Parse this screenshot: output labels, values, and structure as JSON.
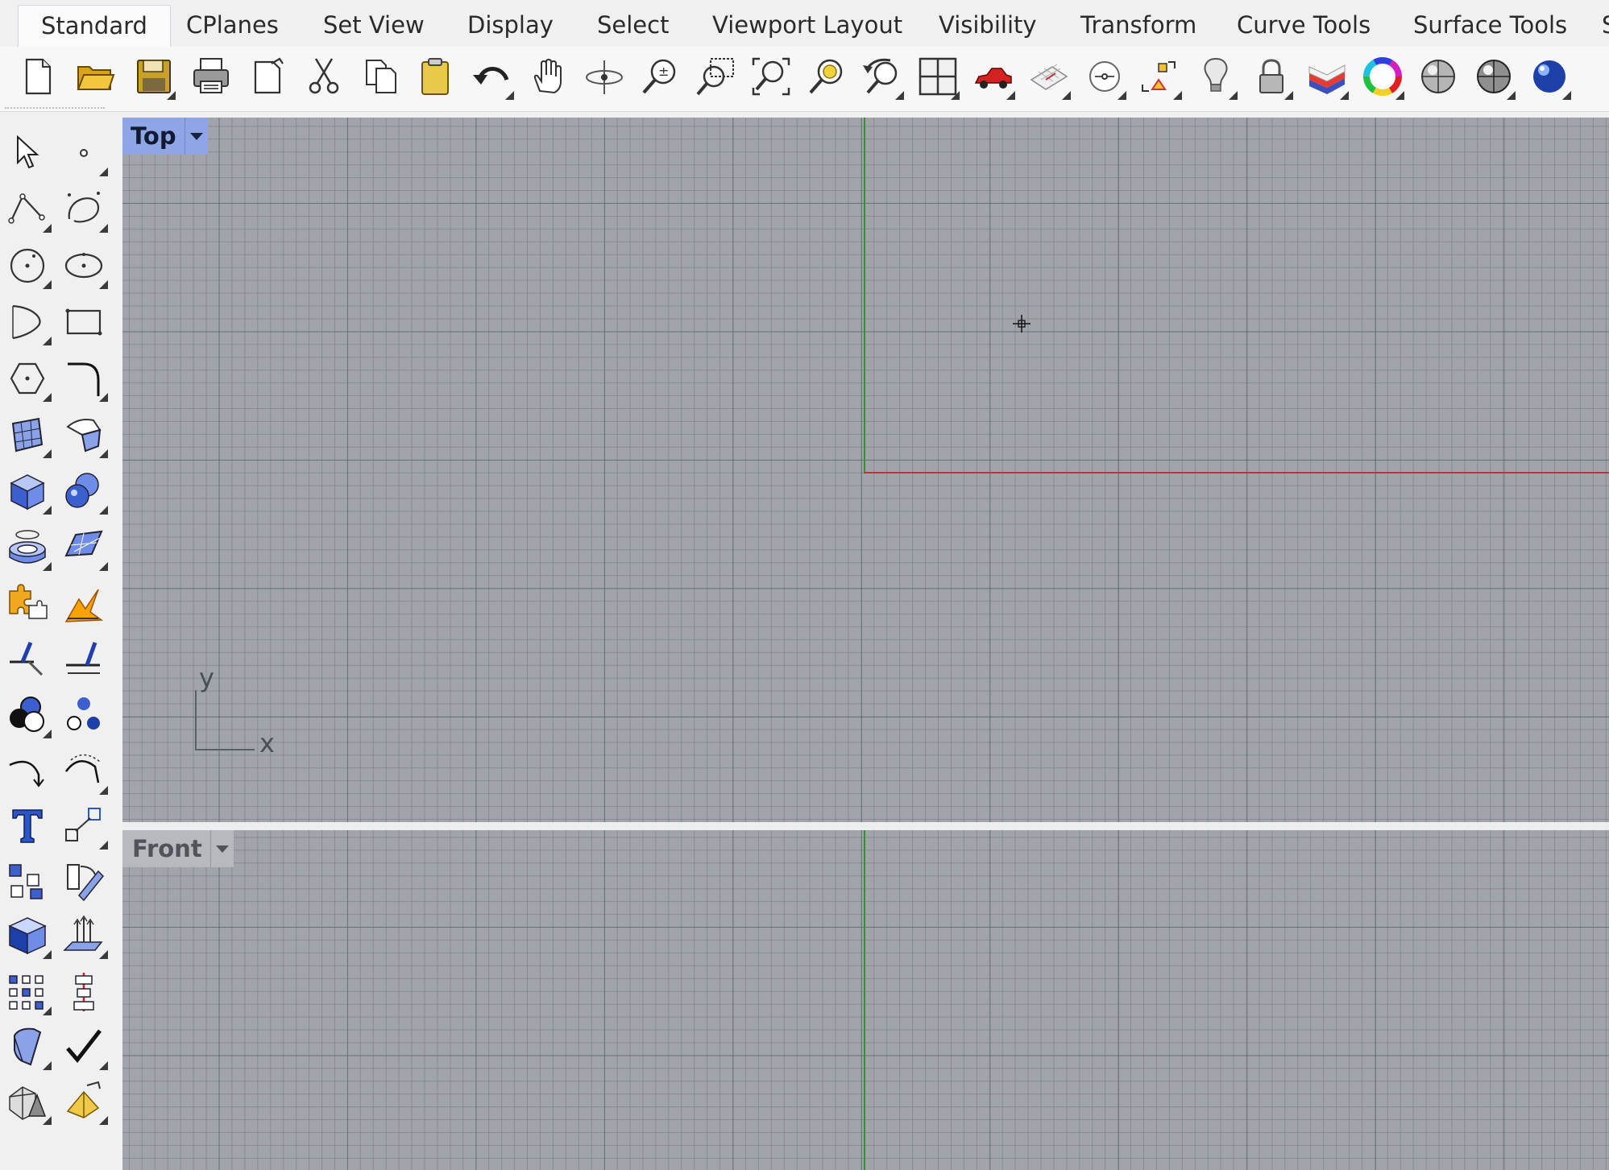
{
  "tabs": [
    "Standard",
    "CPlanes",
    "Set View",
    "Display",
    "Select",
    "Viewport Layout",
    "Visibility",
    "Transform",
    "Curve Tools",
    "Surface Tools",
    "S"
  ],
  "active_tab": "Standard",
  "toolbar_icons": [
    "new-document",
    "open",
    "save",
    "print",
    "import-export",
    "cut",
    "copy",
    "paste",
    "undo",
    "pan",
    "rotate-view",
    "zoom",
    "zoom-window",
    "zoom-extents",
    "zoom-selected",
    "undo-view",
    "four-viewports",
    "car-properties",
    "grid-options",
    "snap-options",
    "object-snap",
    "lightbulb",
    "lock",
    "layers",
    "color-wheel",
    "shaded-sphere",
    "rendered-sphere",
    "blue-sphere"
  ],
  "sidebar_icons": [
    "select",
    "point",
    "polyline",
    "curve",
    "circle",
    "ellipse",
    "arc",
    "rectangle",
    "polygon",
    "fillet",
    "surface-from-points",
    "extrude-surface",
    "box",
    "boolean-union",
    "cylinder",
    "surface-patch",
    "explode",
    "trim",
    "split",
    "split-edge",
    "boolean-solids",
    "boolean-split",
    "rebuild-curve",
    "offset-curve",
    "text",
    "scale",
    "group",
    "rotate-flip",
    "solid-edit",
    "extrude-draft",
    "array",
    "align",
    "bend",
    "check",
    "polygon-mesh",
    "cone"
  ],
  "viewports": {
    "top": {
      "label": "Top",
      "axis_x_label": "x",
      "axis_y_label": "y",
      "active": true
    },
    "front": {
      "label": "Front",
      "active": false
    }
  },
  "colors": {
    "active_viewport_label": "#8ea6e6",
    "viewport_background": "#a1a5ab",
    "x_axis": "#b03a3a",
    "y_axis": "#3d8a3d"
  }
}
